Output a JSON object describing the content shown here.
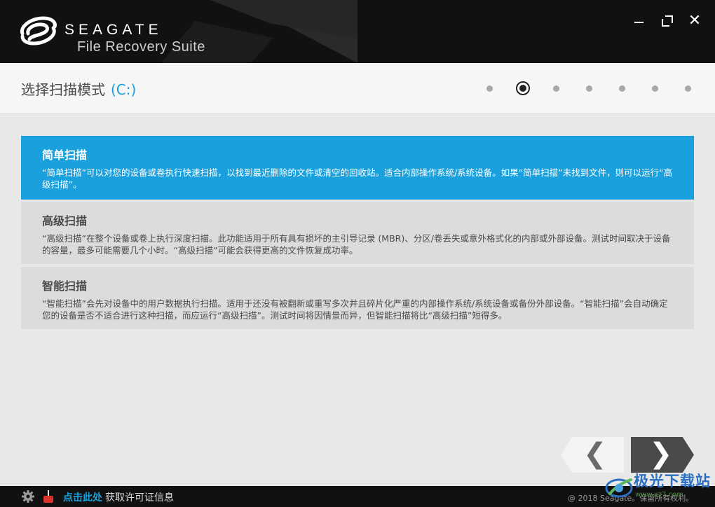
{
  "app": {
    "brand": "SEAGATE",
    "product": "File Recovery Suite"
  },
  "window": {
    "minimize_icon": "minimize-icon",
    "maximize_icon": "maximize-icon",
    "close_icon": "close-icon",
    "close_glyph": "✕"
  },
  "header": {
    "title": "选择扫描模式",
    "drive": "(C:)",
    "steps_total": 7,
    "current_step": 2
  },
  "options": [
    {
      "title": "简单扫描",
      "description": "“简单扫描”可以对您的设备或卷执行快速扫描，以找到最近删除的文件或清空的回收站。适合内部操作系统/系统设备。如果“简单扫描”未找到文件，则可以运行“高级扫描”。",
      "selected": true
    },
    {
      "title": "高级扫描",
      "description": "“高级扫描”在整个设备或卷上执行深度扫描。此功能适用于所有具有损坏的主引导记录 (MBR)、分区/卷丢失或意外格式化的内部或外部设备。测试时间取决于设备的容量，最多可能需要几个小时。“高级扫描”可能会获得更高的文件恢复成功率。",
      "selected": false
    },
    {
      "title": "智能扫描",
      "description": "“智能扫描”会先对设备中的用户数据执行扫描。适用于还没有被翻新或重写多次并且碎片化严重的内部操作系统/系统设备或备份外部设备。“智能扫描”会自动确定您的设备是否不适合进行这种扫描，而应运行“高级扫描”。测试时间将因情景而异，但智能扫描将比“高级扫描”短得多。",
      "selected": false
    }
  ],
  "nav": {
    "back_glyph": "❮",
    "next_glyph": "❯"
  },
  "footer": {
    "link_label": "点击此处",
    "link_info": "获取许可证信息",
    "copyright": "@ 2018 Seagate。保留所有权利。"
  },
  "watermark": {
    "title": "极光下载站",
    "sub": "www.xz7.com"
  },
  "colors": {
    "accent": "#1aa1dd",
    "titlebar": "#111111",
    "option_bg": "#dcdcdc"
  }
}
